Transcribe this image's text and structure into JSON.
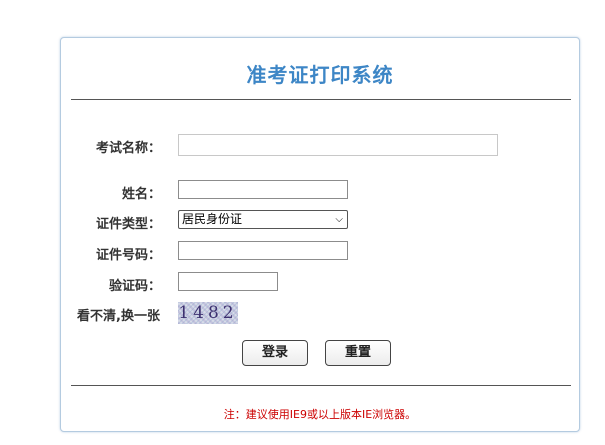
{
  "title": "准考证打印系统",
  "form": {
    "exam_name": {
      "label": "考试名称：",
      "value": ""
    },
    "name": {
      "label": "姓名：",
      "value": ""
    },
    "id_type": {
      "label": "证件类型：",
      "selected": "居民身份证"
    },
    "id_number": {
      "label": "证件号码：",
      "value": ""
    },
    "captcha": {
      "label": "验证码：",
      "value": ""
    },
    "refresh_label": "看不清,换一张",
    "captcha_image_text": "1482"
  },
  "buttons": {
    "login": "登录",
    "reset": "重置"
  },
  "note": "注：建议使用IE9或以上版本IE浏览器。"
}
